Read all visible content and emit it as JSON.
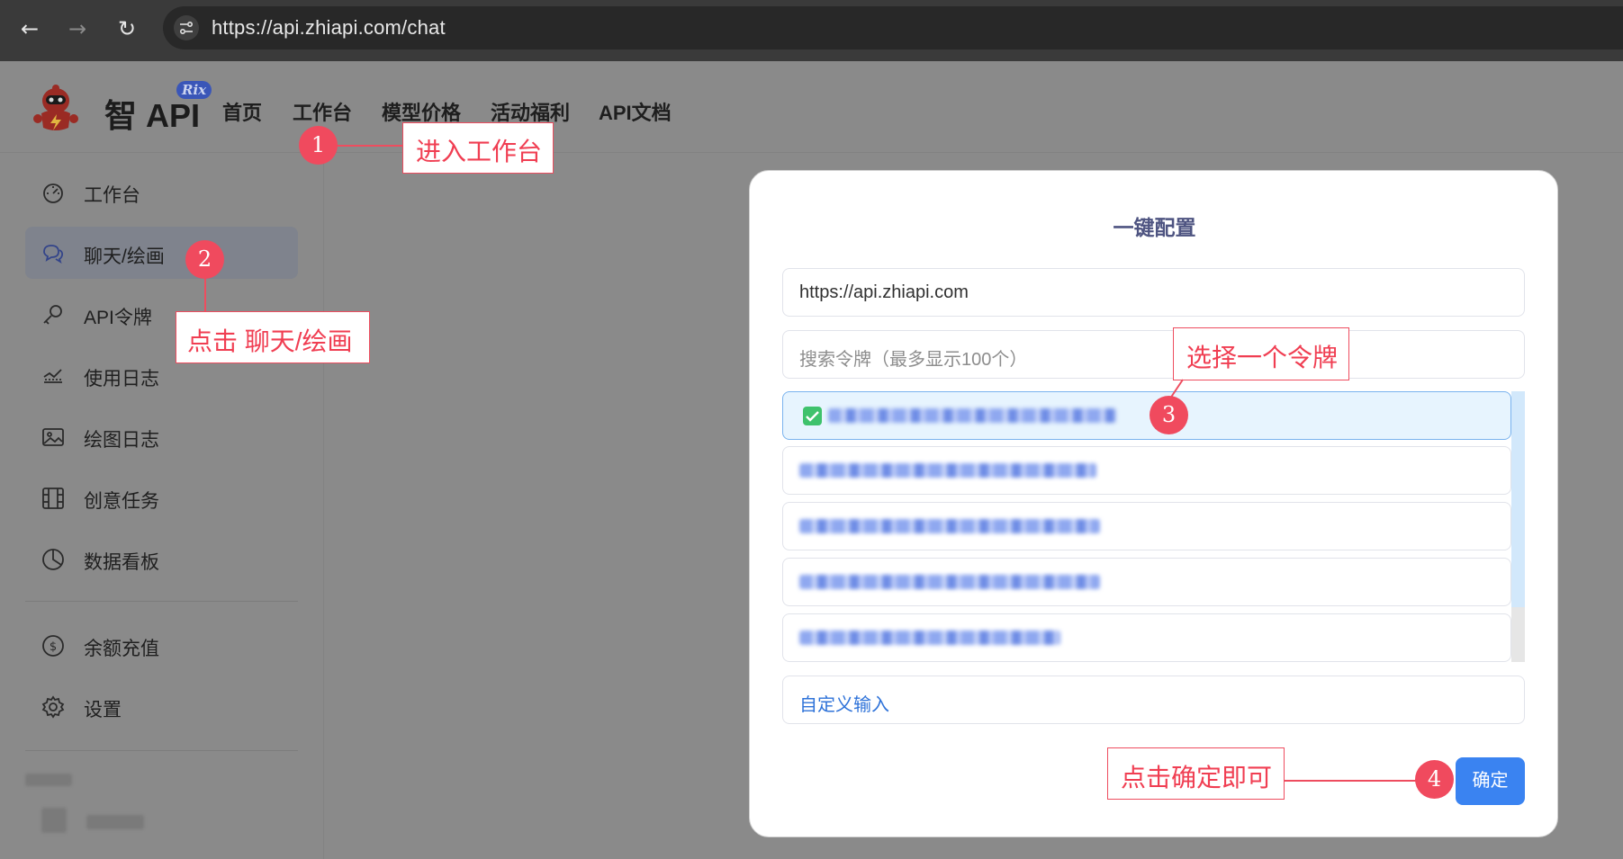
{
  "browser": {
    "url": "https://api.zhiapi.com/chat",
    "back_glyph": "←",
    "forward_glyph": "→",
    "reload_glyph": "↻"
  },
  "header": {
    "brand": "智 API",
    "badge": "Rix",
    "nav": [
      "首页",
      "工作台",
      "模型价格",
      "活动福利",
      "API文档"
    ]
  },
  "sidebar": {
    "items": [
      {
        "label": "工作台",
        "icon": "dashboard-icon"
      },
      {
        "label": "聊天/绘画",
        "icon": "chat-icon",
        "active": true
      },
      {
        "label": "API令牌",
        "icon": "key-icon"
      },
      {
        "label": "使用日志",
        "icon": "log-icon"
      },
      {
        "label": "绘图日志",
        "icon": "image-icon"
      },
      {
        "label": "创意任务",
        "icon": "film-icon"
      },
      {
        "label": "数据看板",
        "icon": "pie-chart-icon"
      }
    ],
    "bottom_items": [
      {
        "label": "余额充值",
        "icon": "dollar-icon"
      },
      {
        "label": "设置",
        "icon": "gear-icon"
      }
    ]
  },
  "modal": {
    "title": "一键配置",
    "base_url": "https://api.zhiapi.com",
    "search_placeholder": "搜索令牌（最多显示100个）",
    "custom_input": "自定义输入",
    "confirm": "确定",
    "tokens": [
      {
        "selected": true
      },
      {
        "selected": false
      },
      {
        "selected": false
      },
      {
        "selected": false
      },
      {
        "selected": false
      }
    ]
  },
  "annotations": [
    {
      "number": "1",
      "text": "进入工作台"
    },
    {
      "number": "2",
      "text": "点击 聊天/绘画"
    },
    {
      "number": "3",
      "text": "选择一个令牌"
    },
    {
      "number": "4",
      "text": "点击确定即可"
    }
  ],
  "colors": {
    "annotation": "#f04a5e",
    "primary_button": "#3a83f1",
    "selected_token_bg": "#e7f4fe",
    "checkbox": "#3fc26c"
  }
}
